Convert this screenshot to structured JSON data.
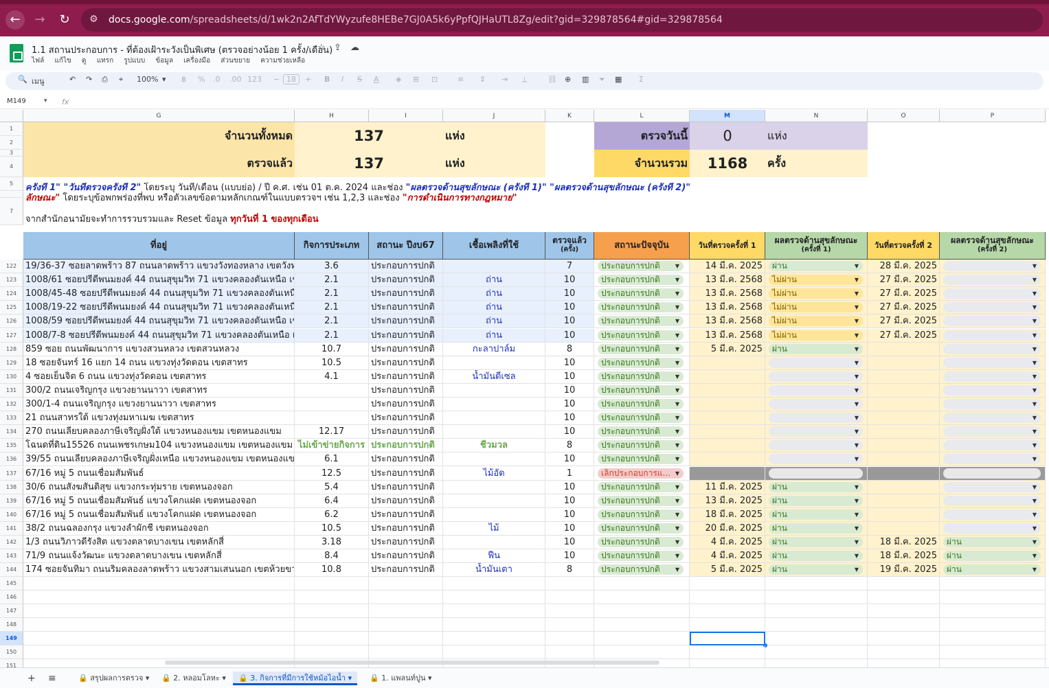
{
  "browser": {
    "url_host": "docs.google.com",
    "url_path": "/spreadsheets/d/1wk2n2AfTdYWyzufe8HEBe7GJ0A5k6yPpfQJHaUTL8Zg/edit?gid=329878564#gid=329878564"
  },
  "doc": {
    "title": "1.1 สถานประกอบการ - ที่ต้องเฝ้าระวังเป็นพิเศษ (ตรวจอย่างน้อย 1 ครั้ง/เดือน)",
    "menus": [
      "ไฟล์",
      "แก้ไข",
      "ดู",
      "แทรก",
      "รูปแบบ",
      "ข้อมูล",
      "เครื่องมือ",
      "ส่วนขยาย",
      "ความช่วยเหลือ"
    ]
  },
  "toolbar": {
    "search": "เมนู",
    "zoom": "100%",
    "font_size": "18",
    "percent": "%",
    "dec_less": ".0",
    "dec_more": ".00",
    "num_fmt": "123"
  },
  "formula": {
    "cell_ref": "M149",
    "fx": "fx"
  },
  "columns": [
    "G",
    "H",
    "I",
    "J",
    "K",
    "L",
    "M",
    "N",
    "O",
    "P"
  ],
  "summary": {
    "total_label": "จำนวนทั้งหมด",
    "total_value": "137",
    "unit_places": "แห่ง",
    "checked_label": "ตรวจแล้ว",
    "checked_value": "137",
    "unit_places2": "แห่ง",
    "today_label": "ตรวจวันนี้",
    "today_value": "0",
    "unit_places3": "แห่ง",
    "sum_label": "จำนวนรวม",
    "sum_value": "1168",
    "unit_times": "ครั้ง"
  },
  "notes": {
    "row4_a": "ครั้งที่ 1\" \"วันที่ตรวจครั้งที่ 2\"",
    "row4_b": " โดยระบุ วันที่/เดือน (แบบย่อ) / ปี ค.ศ. เช่น 01 ต.ค. 2024  และช่อง ",
    "row4_c": "\"ผลตรวจด้านสุขลักษณะ (ครั้งที่ 1)\" \"ผลตรวจด้านสุขลักษณะ (ครั้งที่ 2)\"",
    "row4b_a": "ลักษณะ\"",
    "row4b_b": " โดยระบุข้อพกพร่องที่พบ หรือตัวเลขข้อตามหลักเกณฑ์ในแบบตรวจฯ เช่น 1,2,3 และช่อง ",
    "row4b_c": "\"การดำเนินการทางกฎหมาย\"",
    "row5_a": "จากสำนักอนามัยจะทำการรวบรวมและ Reset ข้อมูล ",
    "row5_b": "ทุกวันที่ 1 ของทุกเดือน"
  },
  "headers": {
    "address": "ที่อยู่",
    "activity": "กิจการประเภท",
    "status67": "สถานะ ปีงบ67",
    "fuel": "เชื้อเพลิงที่ใช้",
    "checked_a": "ตรวจแล้ว",
    "checked_b": "(ครั้ง)",
    "current_status": "สถานะปัจจุบัน",
    "date1": "วันที่ตรวจครั้งที่ 1",
    "result1_a": "ผลตรวจด้านสุขลักษณะ",
    "result1_b": "(ครั้งที่ 1)",
    "date2": "วันที่ตรวจครั้งที่ 2",
    "result2_a": "ผลตรวจด้านสุขลักษณะ",
    "result2_b": "(ครั้งที่ 2)"
  },
  "top_rows": [
    "1",
    "2",
    "3",
    "4",
    "5",
    "",
    "7"
  ],
  "rows": [
    {
      "n": "122",
      "addr": "19/36-37 ซอยลาดพร้าว 87 ถนนลาดพร้าว แขวงวังทองหลาง เขตวังทองหล",
      "act": "3.6",
      "st": "ประกอบการปกติ",
      "fuel": "",
      "chk": "7",
      "cur": "ประกอบการปกติ",
      "d1": "14 มี.ค. 2025",
      "r1": "ผ่าน",
      "d2": "28 มี.ค. 2025",
      "r2": ""
    },
    {
      "n": "123",
      "addr": "1008/61 ซอยปรีดีพนมยงค์ 44 ถนนสุขุมวิท 71 แขวงคลองตันเหนือ เขตวัฒ",
      "act": "2.1",
      "st": "ประกอบการปกติ",
      "fuel": "ถ่าน",
      "chk": "10",
      "cur": "ประกอบการปกติ",
      "d1": "13 มี.ค. 2568",
      "r1": "ไม่ผ่าน",
      "d2": "27 มี.ค. 2025",
      "r2": ""
    },
    {
      "n": "124",
      "addr": "1008/45-48 ซอยปรีดีพนมยงค์ 44 ถนนสุขุมวิท 71 แขวงคลองตันเหนือ เขต",
      "act": "2.1",
      "st": "ประกอบการปกติ",
      "fuel": "ถ่าน",
      "chk": "10",
      "cur": "ประกอบการปกติ",
      "d1": "13 มี.ค. 2568",
      "r1": "ไม่ผ่าน",
      "d2": "27 มี.ค. 2025",
      "r2": ""
    },
    {
      "n": "125",
      "addr": "1008/19-22 ซอยปรีดีพนมยงค์ 44 ถนนสุขุมวิท 71 แขวงคลองตันเหนือ เขต",
      "act": "2.1",
      "st": "ประกอบการปกติ",
      "fuel": "ถ่าน",
      "chk": "10",
      "cur": "ประกอบการปกติ",
      "d1": "13 มี.ค. 2568",
      "r1": "ไม่ผ่าน",
      "d2": "27 มี.ค. 2025",
      "r2": ""
    },
    {
      "n": "126",
      "addr": "1008/59 ซอยปรีดีพนมยงค์ 44 ถนนสุขุมวิท 71 แขวงคลองตันเหนือ เขตวัฒ",
      "act": "2.1",
      "st": "ประกอบการปกติ",
      "fuel": "ถ่าน",
      "chk": "10",
      "cur": "ประกอบการปกติ",
      "d1": "13 มี.ค. 2568",
      "r1": "ไม่ผ่าน",
      "d2": "27 มี.ค. 2025",
      "r2": ""
    },
    {
      "n": "127",
      "addr": "1008/7-8 ซอยปรีดีพนมยงค์ 44 ถนนสุขุมวิท 71 แขวงคลองตันเหนือ เขตวัฒ",
      "act": "2.1",
      "st": "ประกอบการปกติ",
      "fuel": "ถ่าน",
      "chk": "10",
      "cur": "ประกอบการปกติ",
      "d1": "13 มี.ค. 2568",
      "r1": "ไม่ผ่าน",
      "d2": "27 มี.ค. 2025",
      "r2": ""
    },
    {
      "n": "128",
      "addr": "859 ซอย ถนนพัฒนาการ แขวงสวนหลวง เขตสวนหลวง",
      "act": "10.7",
      "st": "ประกอบการปกติ",
      "fuel": "กะลาปาล์ม",
      "chk": "8",
      "cur": "ประกอบการปกติ",
      "d1": "5 มี.ค. 2025",
      "r1": "ผ่าน",
      "d2": "",
      "r2": ""
    },
    {
      "n": "129",
      "addr": "18 ซอยจันทร์ 16 แยก 14 ถนน แขวงทุ่งวัดดอน เขตสาทร",
      "act": "10.5",
      "st": "ประกอบการปกติ",
      "fuel": "",
      "chk": "10",
      "cur": "ประกอบการปกติ",
      "d1": "",
      "r1": "",
      "d2": "",
      "r2": ""
    },
    {
      "n": "130",
      "addr": "4 ซอยเย็นจิต 6 ถนน แขวงทุ่งวัดดอน เขตสาทร",
      "act": "4.1",
      "st": "ประกอบการปกติ",
      "fuel": "น้ำมันดีเซล",
      "chk": "10",
      "cur": "ประกอบการปกติ",
      "d1": "",
      "r1": "",
      "d2": "",
      "r2": ""
    },
    {
      "n": "131",
      "addr": "300/2 ถนนเจริญกรุง แขวงยานนาวา เขตสาทร",
      "act": "",
      "st": "ประกอบการปกติ",
      "fuel": "",
      "chk": "10",
      "cur": "ประกอบการปกติ",
      "d1": "",
      "r1": "",
      "d2": "",
      "r2": ""
    },
    {
      "n": "132",
      "addr": "300/1-4 ถนนเจริญกรุง แขวงยานนาวา เขตสาทร",
      "act": "",
      "st": "ประกอบการปกติ",
      "fuel": "",
      "chk": "10",
      "cur": "ประกอบการปกติ",
      "d1": "",
      "r1": "",
      "d2": "",
      "r2": ""
    },
    {
      "n": "133",
      "addr": "21 ถนนสาทรใต้ แขวงทุ่งมหาเมฆ เขตสาทร",
      "act": "",
      "st": "ประกอบการปกติ",
      "fuel": "",
      "chk": "10",
      "cur": "ประกอบการปกติ",
      "d1": "",
      "r1": "",
      "d2": "",
      "r2": ""
    },
    {
      "n": "134",
      "addr": "270 ถนนเลียบคลองภาษีเจริญฝั่งใต้ แขวงหนองแขม เขตหนองแขม",
      "act": "12.17",
      "st": "ประกอบการปกติ",
      "fuel": "",
      "chk": "10",
      "cur": "ประกอบการปกติ",
      "d1": "",
      "r1": "",
      "d2": "",
      "r2": ""
    },
    {
      "n": "135",
      "addr": "โฉนดที่ดิน15526 ถนนเพชรเกษม104 แขวงหนองแขม เขตหนองแขม",
      "act": "ไม่เข้าข่ายกิจการ",
      "st": "ประกอบการปกติ",
      "fuel": "ชีวมวล",
      "chk": "8",
      "cur": "ประกอบการปกติ",
      "d1": "",
      "r1": "",
      "d2": "",
      "r2": "",
      "green": true
    },
    {
      "n": "136",
      "addr": "39/55  ถนนเลียบคลองภาษีเจริญฝั่งเหนือ แขวงหนองแขม เขตหนองแขม",
      "act": "6.1",
      "st": "ประกอบการปกติ",
      "fuel": "",
      "chk": "10",
      "cur": "ประกอบการปกติ",
      "d1": "",
      "r1": "",
      "d2": "",
      "r2": ""
    },
    {
      "n": "137",
      "addr": "67/16 หมู่ 5 ถนนเชื่อมสัมพันธ์",
      "act": "12.5",
      "st": "ประกอบการปกติ",
      "fuel": "ไม้อัด",
      "chk": "1",
      "cur": "เลิกประกอบการแ...",
      "d1": "",
      "r1": "",
      "d2": "",
      "r2": "",
      "closed": true
    },
    {
      "n": "138",
      "addr": "30/6  ถนนสังฆสันติสุข แขวงกระทุ่มราย เขตหนองจอก",
      "act": "5.4",
      "st": "ประกอบการปกติ",
      "fuel": "",
      "chk": "10",
      "cur": "ประกอบการปกติ",
      "d1": "11 มี.ค. 2025",
      "r1": "ผ่าน",
      "d2": "",
      "r2": ""
    },
    {
      "n": "139",
      "addr": "67/16 หมู่ 5 ถนนเชื่อมสัมพันธ์ แขวงโคกแฝด เขตหนองจอก",
      "act": "6.4",
      "st": "ประกอบการปกติ",
      "fuel": "",
      "chk": "10",
      "cur": "ประกอบการปกติ",
      "d1": "13 มี.ค. 2025",
      "r1": "ผ่าน",
      "d2": "",
      "r2": ""
    },
    {
      "n": "140",
      "addr": "67/16 หมู่ 5 ถนนเชื่อมสัมพันธ์ แขวงโคกแฝด เขตหนองจอก",
      "act": "6.2",
      "st": "ประกอบการปกติ",
      "fuel": "",
      "chk": "10",
      "cur": "ประกอบการปกติ",
      "d1": "18 มี.ค. 2025",
      "r1": "ผ่าน",
      "d2": "",
      "r2": ""
    },
    {
      "n": "141",
      "addr": "38/2  ถนนฉลองกรุง แขวงลำผักชี เขตหนองจอก",
      "act": "10.5",
      "st": "ประกอบการปกติ",
      "fuel": "ไม้",
      "chk": "10",
      "cur": "ประกอบการปกติ",
      "d1": "20 มี.ค. 2025",
      "r1": "ผ่าน",
      "d2": "",
      "r2": ""
    },
    {
      "n": "142",
      "addr": "1/3 ถนนวิภาวดีรังสิต แขวงตลาดบางเขน เขตหลักสี่",
      "act": "3.18",
      "st": "ประกอบการปกติ",
      "fuel": "",
      "chk": "10",
      "cur": "ประกอบการปกติ",
      "d1": "4 มี.ค. 2025",
      "r1": "ผ่าน",
      "d2": "18 มี.ค. 2025",
      "r2": "ผ่าน"
    },
    {
      "n": "143",
      "addr": "71/9 ถนนแจ้งวัฒนะ แขวงตลาดบางเขน เขตหลักสี่",
      "act": "8.4",
      "st": "ประกอบการปกติ",
      "fuel": "ฟืน",
      "chk": "10",
      "cur": "ประกอบการปกติ",
      "d1": "4 มี.ค. 2025",
      "r1": "ผ่าน",
      "d2": "18 มี.ค. 2025",
      "r2": "ผ่าน"
    },
    {
      "n": "144",
      "addr": "174 ซอยจันทิมา ถนนริมคลองลาดพร้าว แขวงสามเสนนอก เขตห้วยขวาง",
      "act": "10.8",
      "st": "ประกอบการปกติ",
      "fuel": "น้ำมันเตา",
      "chk": "8",
      "cur": "ประกอบการปกติ",
      "d1": "5 มี.ค. 2025",
      "r1": "ผ่าน",
      "d2": "19 มี.ค. 2025",
      "r2": "ผ่าน"
    }
  ],
  "empty_rows": [
    "145",
    "146",
    "147",
    "148",
    "149",
    "150",
    "151"
  ],
  "selected_row": "149",
  "sheets": {
    "add": "+",
    "list": "≡",
    "tabs": [
      {
        "label": "สรุปผลการตรวจ"
      },
      {
        "label": "2. หลอมโลหะ"
      },
      {
        "label": "3. กิจการที่มีการใช้หม้อไอน้ำ",
        "active": true
      },
      {
        "label": "1. แพลนท์ปูน"
      }
    ]
  },
  "colors": {
    "chrome": "#8e1c4c",
    "blue_header": "#9fc5e8",
    "orange_header": "#f6a04d",
    "pass": "#d9ead3",
    "fail": "#ffe599",
    "closed": "#f4cccc",
    "accent": "#0b57d0"
  }
}
